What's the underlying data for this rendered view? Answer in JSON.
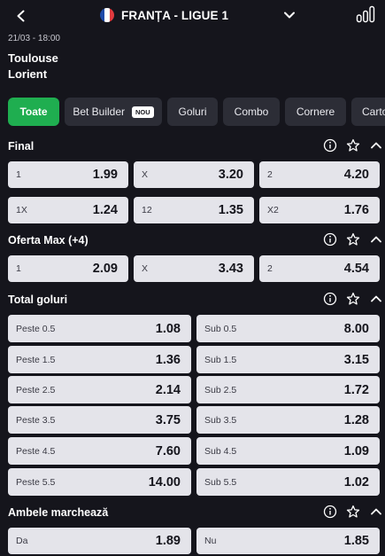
{
  "header": {
    "title": "FRANȚA - LIGUE 1",
    "flag_colors": [
      "#1f4aa8",
      "#ffffff",
      "#e03a3e"
    ]
  },
  "match": {
    "datetime": "21/03 - 18:00",
    "home": "Toulouse",
    "away": "Lorient"
  },
  "tabs": [
    {
      "label": "Toate",
      "active": true
    },
    {
      "label": "Bet Builder",
      "badge": "NOU"
    },
    {
      "label": "Goluri"
    },
    {
      "label": "Combo"
    },
    {
      "label": "Cornere"
    },
    {
      "label": "Carto"
    }
  ],
  "sections": {
    "final": {
      "title": "Final",
      "rows": [
        [
          {
            "label": "1",
            "odd": "1.99"
          },
          {
            "label": "X",
            "odd": "3.20"
          },
          {
            "label": "2",
            "odd": "4.20"
          }
        ],
        [
          {
            "label": "1X",
            "odd": "1.24"
          },
          {
            "label": "12",
            "odd": "1.35"
          },
          {
            "label": "X2",
            "odd": "1.76"
          }
        ]
      ]
    },
    "oferta": {
      "title": "Oferta Max (+4)",
      "rows": [
        [
          {
            "label": "1",
            "odd": "2.09"
          },
          {
            "label": "X",
            "odd": "3.43"
          },
          {
            "label": "2",
            "odd": "4.54"
          }
        ]
      ]
    },
    "total": {
      "title": "Total goluri",
      "rows": [
        [
          {
            "label": "Peste 0.5",
            "odd": "1.08"
          },
          {
            "label": "Sub 0.5",
            "odd": "8.00"
          }
        ],
        [
          {
            "label": "Peste 1.5",
            "odd": "1.36"
          },
          {
            "label": "Sub 1.5",
            "odd": "3.15"
          }
        ],
        [
          {
            "label": "Peste 2.5",
            "odd": "2.14"
          },
          {
            "label": "Sub 2.5",
            "odd": "1.72"
          }
        ],
        [
          {
            "label": "Peste 3.5",
            "odd": "3.75"
          },
          {
            "label": "Sub 3.5",
            "odd": "1.28"
          }
        ],
        [
          {
            "label": "Peste 4.5",
            "odd": "7.60"
          },
          {
            "label": "Sub 4.5",
            "odd": "1.09"
          }
        ],
        [
          {
            "label": "Peste 5.5",
            "odd": "14.00"
          },
          {
            "label": "Sub 5.5",
            "odd": "1.02"
          }
        ]
      ]
    },
    "ambele": {
      "title": "Ambele marchează",
      "rows": [
        [
          {
            "label": "Da",
            "odd": "1.89"
          },
          {
            "label": "Nu",
            "odd": "1.85"
          }
        ]
      ]
    }
  }
}
